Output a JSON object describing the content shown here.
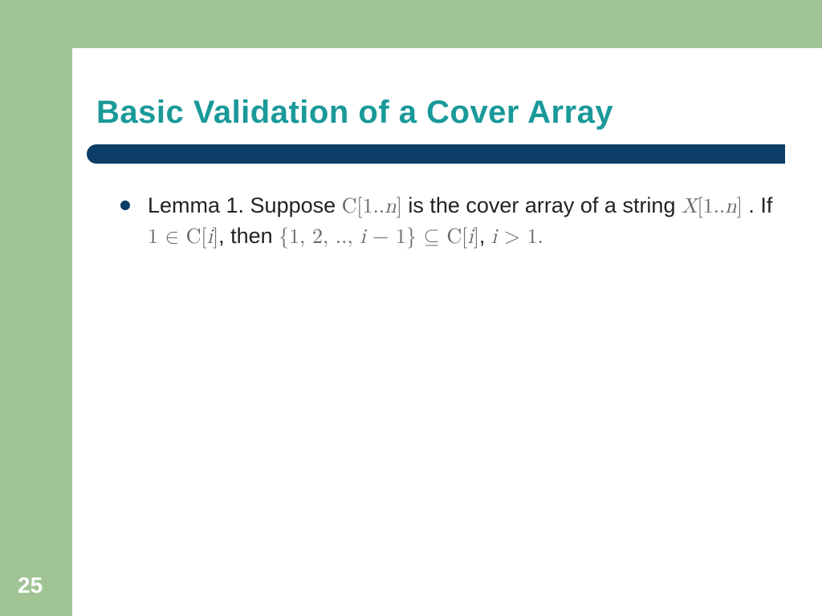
{
  "slide": {
    "title": "Basic Validation of a Cover Array",
    "pageNumber": "25",
    "lemma": {
      "lead": "Lemma 1.  Suppose ",
      "m1": "C[1..n]",
      "mid1": " is the cover array of a  string ",
      "m2": "X[1..n]",
      "mid2": " .  If ",
      "m3": "1 ∈ C[i]",
      "mid3": ", then ",
      "m4": "{1, 2, .., i − 1} ⊆ C[i]",
      "mid4": ", ",
      "m5": "i > 1."
    }
  }
}
